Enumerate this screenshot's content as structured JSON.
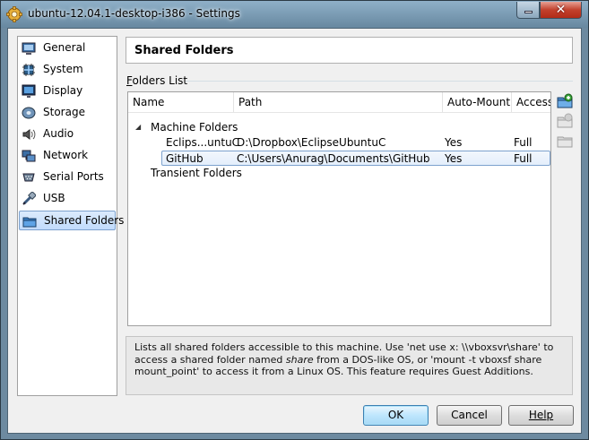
{
  "window": {
    "title": "ubuntu-12.04.1-desktop-i386 - Settings",
    "close_glyph": "✕"
  },
  "sidebar": {
    "items": [
      {
        "label": "General",
        "icon": "monitor-icon"
      },
      {
        "label": "System",
        "icon": "chip-icon"
      },
      {
        "label": "Display",
        "icon": "display-icon"
      },
      {
        "label": "Storage",
        "icon": "disk-icon"
      },
      {
        "label": "Audio",
        "icon": "speaker-icon"
      },
      {
        "label": "Network",
        "icon": "network-icon"
      },
      {
        "label": "Serial Ports",
        "icon": "serial-port-icon"
      },
      {
        "label": "USB",
        "icon": "usb-icon"
      },
      {
        "label": "Shared Folders",
        "icon": "folder-icon",
        "selected": true
      }
    ]
  },
  "main": {
    "title": "Shared Folders",
    "group_label_prefix": "F",
    "group_label_rest": "olders List",
    "columns": [
      "Name",
      "Path",
      "Auto-Mount",
      "Access"
    ],
    "tree": {
      "machine_group": "Machine Folders",
      "transient_group": "Transient Folders",
      "rows": [
        {
          "name": "Eclips...untuC",
          "path": "D:\\Dropbox\\EclipseUbuntuC",
          "auto_mount": "Yes",
          "access": "Full"
        },
        {
          "name": "GitHub",
          "path": "C:\\Users\\Anurag\\Documents\\GitHub",
          "auto_mount": "Yes",
          "access": "Full"
        }
      ]
    },
    "info": {
      "part1": "Lists all shared folders accessible to this machine. Use 'net use x: \\\\vboxsvr\\share' to access a shared folder named ",
      "emph": "share",
      "part2": " from a DOS-like OS, or 'mount -t vboxsf share mount_point' to access it from a Linux OS. This feature requires Guest Additions."
    }
  },
  "buttons": {
    "ok": "OK",
    "cancel": "Cancel",
    "help": "Help"
  },
  "colors": {
    "selection_border": "#7da2ce",
    "titlebar": "#6788a0",
    "close_button": "#c2412d"
  }
}
